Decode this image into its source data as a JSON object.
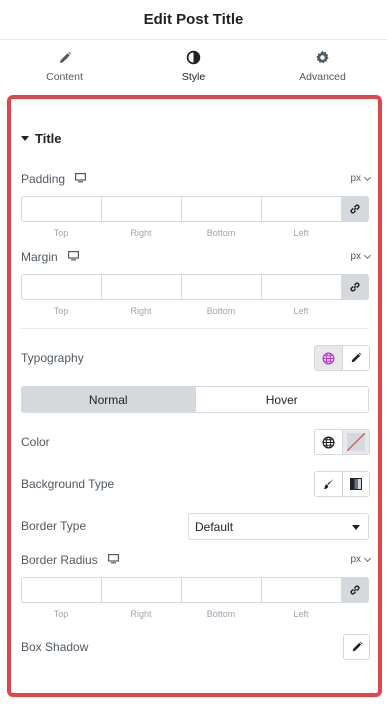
{
  "header": {
    "title": "Edit Post Title"
  },
  "tabs": [
    {
      "label": "Content",
      "icon": "pencil-icon"
    },
    {
      "label": "Style",
      "icon": "contrast-icon",
      "active": true
    },
    {
      "label": "Advanced",
      "icon": "gear-icon"
    }
  ],
  "section": {
    "title": "Title"
  },
  "padding": {
    "label": "Padding",
    "unit": "px",
    "sides": [
      "Top",
      "Right",
      "Bottom",
      "Left"
    ]
  },
  "margin": {
    "label": "Margin",
    "unit": "px",
    "sides": [
      "Top",
      "Right",
      "Bottom",
      "Left"
    ]
  },
  "typography": {
    "label": "Typography"
  },
  "state_toggle": {
    "options": [
      "Normal",
      "Hover"
    ],
    "selected": "Normal"
  },
  "color": {
    "label": "Color"
  },
  "background_type": {
    "label": "Background Type"
  },
  "border_type": {
    "label": "Border Type",
    "value": "Default"
  },
  "border_radius": {
    "label": "Border Radius",
    "unit": "px",
    "sides": [
      "Top",
      "Right",
      "Bottom",
      "Left"
    ]
  },
  "box_shadow": {
    "label": "Box Shadow"
  },
  "colors": {
    "highlight_border": "#e0454d",
    "accent_pink": "#c036d9",
    "muted_text": "#9da5ae"
  }
}
